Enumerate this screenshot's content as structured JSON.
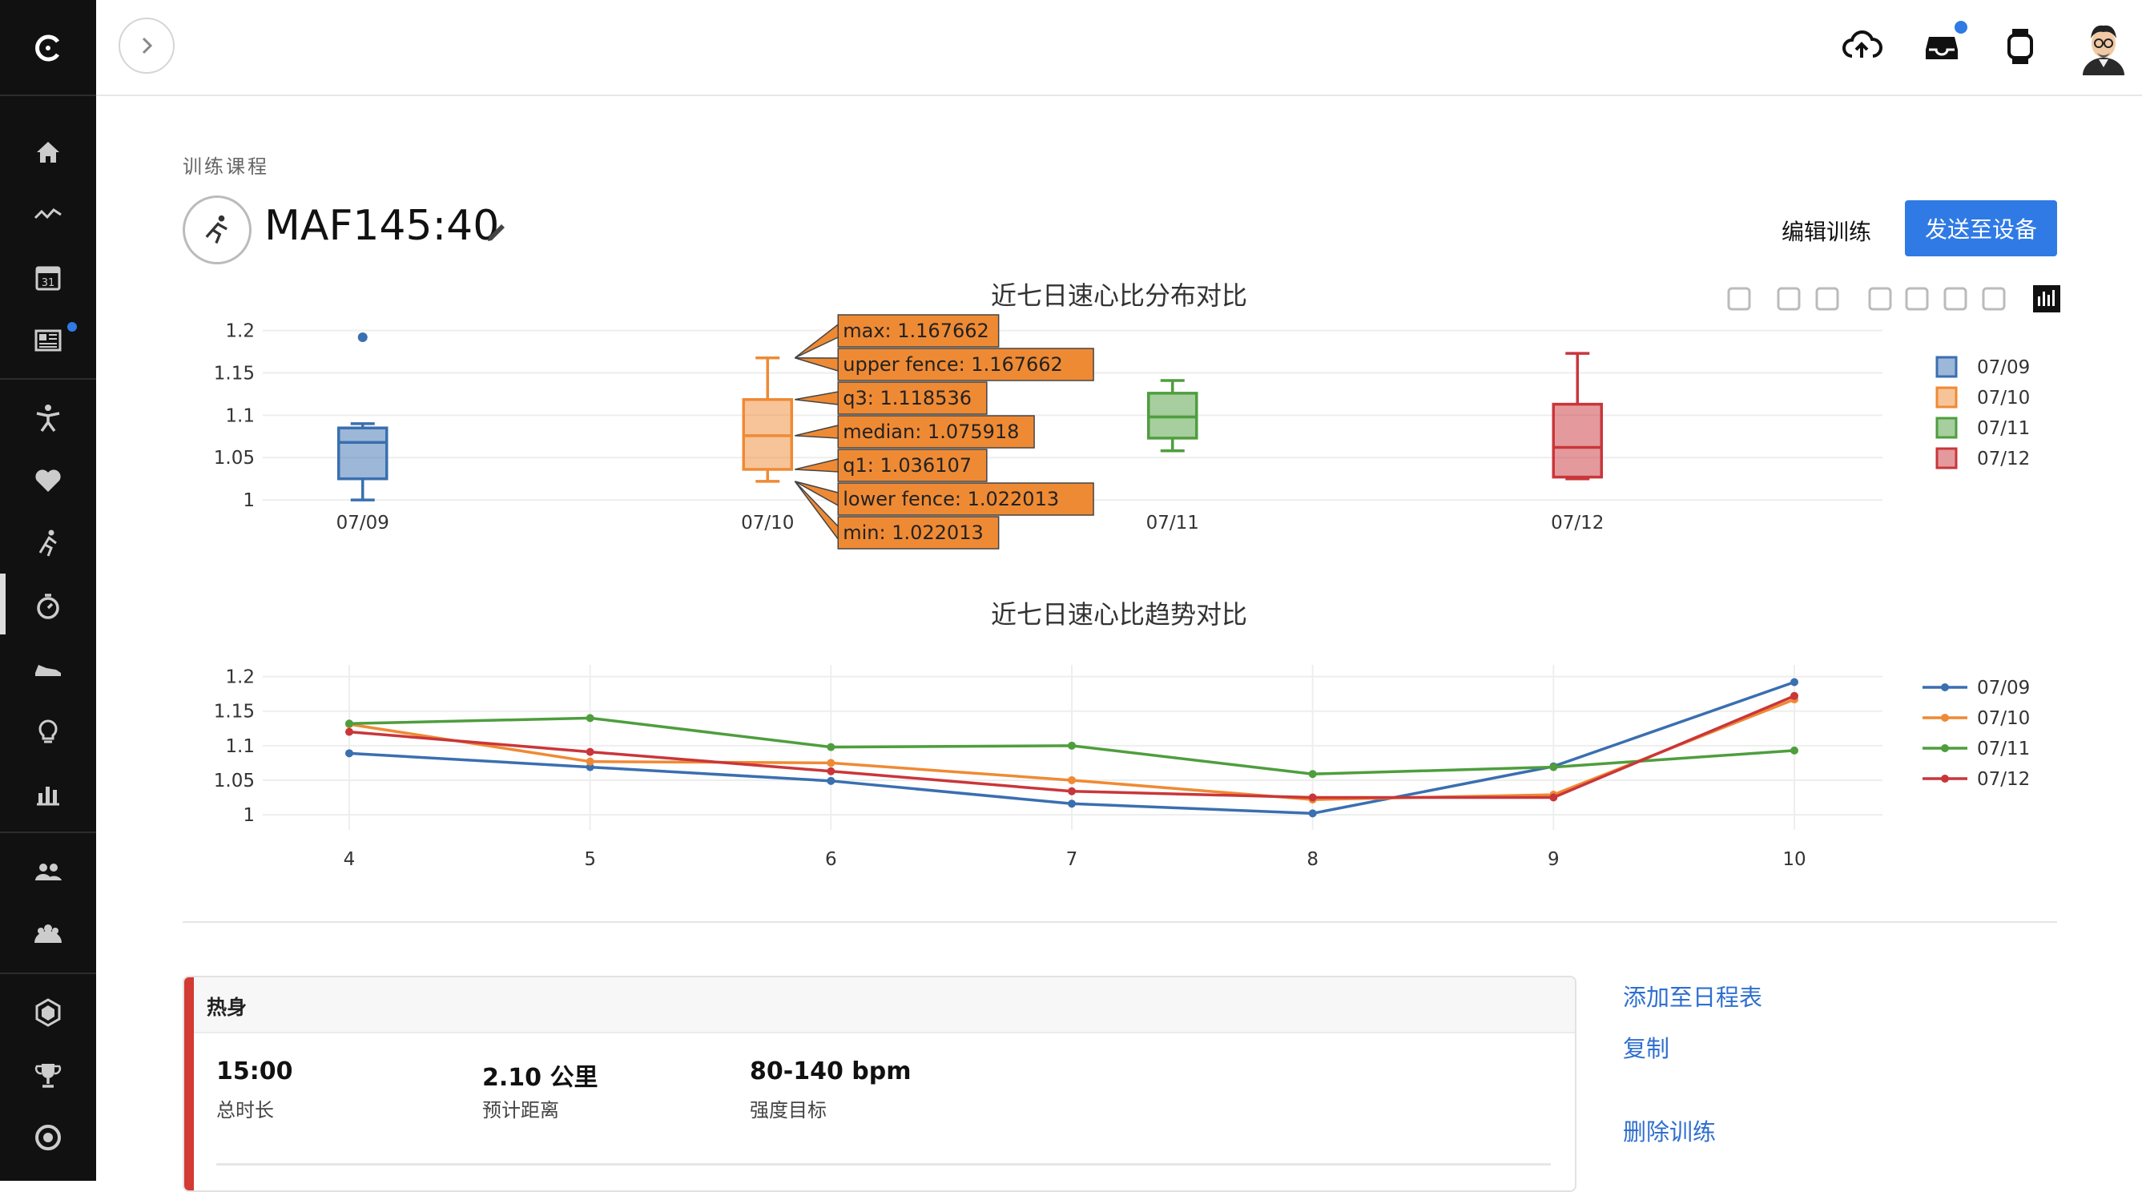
{
  "header": {
    "upload_icon": "cloud-upload-icon",
    "inbox_icon": "inbox-icon",
    "watch_icon": "watch-icon",
    "avatar_icon": "user-avatar"
  },
  "sidebar": {
    "items": [
      "logo-icon",
      "home-icon",
      "activity-icon",
      "calendar-icon",
      "news-icon",
      "training-icon",
      "health-icon",
      "running-icon",
      "stopwatch-icon",
      "shoe-icon",
      "lightbulb-icon",
      "stats-icon",
      "friends-icon",
      "group-icon",
      "badge-icon",
      "trophy-icon",
      "target-icon"
    ],
    "calendar_day": "31",
    "active_item": "stopwatch-icon",
    "accent_color": "#2f7ae5"
  },
  "page": {
    "breadcrumb": "训练课程",
    "title": "MAF145:40",
    "edit_button": "编辑训练",
    "send_button": "发送至设备",
    "send_button_color": "#2f7ae5"
  },
  "chart_data": [
    {
      "type": "box",
      "title": "近七日速心比分布对比",
      "categories": [
        "07/09",
        "07/10",
        "07/11",
        "07/12"
      ],
      "yticks": [
        "1",
        "1.05",
        "1.1",
        "1.15",
        "1.2"
      ],
      "ylim": [
        0.985,
        1.21
      ],
      "series": [
        {
          "name": "07/09",
          "color": "#3a6fb0",
          "min": 1.0,
          "q1": 1.025,
          "median": 1.068,
          "q3": 1.085,
          "max": 1.09,
          "outliers": [
            1.192
          ]
        },
        {
          "name": "07/10",
          "color": "#ef8a34",
          "min": 1.022013,
          "q1": 1.036107,
          "median": 1.075918,
          "q3": 1.118536,
          "max": 1.167662
        },
        {
          "name": "07/11",
          "color": "#4e9e3d",
          "min": 1.058,
          "q1": 1.073,
          "median": 1.098,
          "q3": 1.126,
          "max": 1.141
        },
        {
          "name": "07/12",
          "color": "#c9363a",
          "min": 1.025,
          "q1": 1.027,
          "median": 1.062,
          "q3": 1.113,
          "max": 1.173
        }
      ],
      "hover": {
        "category": "07/10",
        "labels": [
          "max: 1.167662",
          "upper fence: 1.167662",
          "q3: 1.118536",
          "median: 1.075918",
          "q1: 1.036107",
          "lower fence: 1.022013",
          "min: 1.022013"
        ]
      },
      "modebar": [
        "camera-icon",
        "zoom-icon",
        "pan-icon",
        "zoom-in-icon",
        "zoom-out-icon",
        "autoscale-icon",
        "reset-icon",
        "plotly-logo-icon"
      ],
      "legend_position": "right"
    },
    {
      "type": "line",
      "title": "近七日速心比趋势对比",
      "x": [
        4,
        5,
        6,
        7,
        8,
        9,
        10
      ],
      "yticks": [
        "1",
        "1.05",
        "1.1",
        "1.15",
        "1.2"
      ],
      "ylim": [
        0.985,
        1.21
      ],
      "series": [
        {
          "name": "07/09",
          "color": "#3a6fb0",
          "values": [
            1.089,
            1.069,
            1.049,
            1.016,
            1.002,
            1.07,
            1.192
          ]
        },
        {
          "name": "07/10",
          "color": "#ef8a34",
          "values": [
            1.131,
            1.077,
            1.075,
            1.05,
            1.022,
            1.029,
            1.167
          ]
        },
        {
          "name": "07/11",
          "color": "#4e9e3d",
          "values": [
            1.132,
            1.14,
            1.098,
            1.1,
            1.059,
            1.069,
            1.093
          ]
        },
        {
          "name": "07/12",
          "color": "#c9363a",
          "values": [
            1.12,
            1.091,
            1.063,
            1.034,
            1.025,
            1.025,
            1.172
          ]
        }
      ],
      "legend_position": "right"
    }
  ],
  "step": {
    "name": "热身",
    "accent_color": "#d23a33",
    "duration_value": "15:00",
    "duration_label": "总时长",
    "distance_value": "2.10 公里",
    "distance_label": "预计距离",
    "intensity_value": "80-140 bpm",
    "intensity_label": "强度目标"
  },
  "actions": {
    "add_calendar": "添加至日程表",
    "copy": "复制",
    "delete": "删除训练"
  }
}
